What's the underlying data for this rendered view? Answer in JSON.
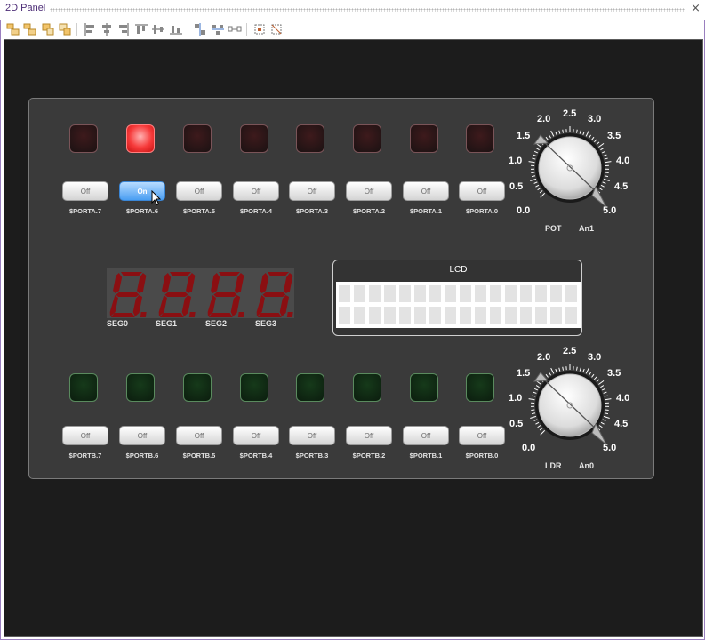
{
  "window": {
    "title": "2D Panel",
    "close_glyph": "×"
  },
  "toolbar": {
    "icons": [
      "align-left-icon",
      "align-top-icon",
      "bring-front-icon",
      "send-back-icon",
      "align-center-v-icon",
      "align-middle-icon",
      "align-right-icon",
      "align-bottom-icon",
      "distribute-h-icon",
      "distribute-v-icon",
      "space-h-icon",
      "space-v-icon",
      "space-even-icon",
      "fit-icon",
      "crop-icon"
    ]
  },
  "colors": {
    "led_red_on": "#f63a3a",
    "switch_on": "#4a9ef2",
    "panel_bg": "#3a3a3a",
    "canvas_bg": "#1c1c1c"
  },
  "porta": {
    "leds": [
      "off",
      "on",
      "off",
      "off",
      "off",
      "off",
      "off",
      "off"
    ],
    "switches": [
      {
        "label": "$PORTA.7",
        "state": "Off"
      },
      {
        "label": "$PORTA.6",
        "state": "On"
      },
      {
        "label": "$PORTA.5",
        "state": "Off"
      },
      {
        "label": "$PORTA.4",
        "state": "Off"
      },
      {
        "label": "$PORTA.3",
        "state": "Off"
      },
      {
        "label": "$PORTA.2",
        "state": "Off"
      },
      {
        "label": "$PORTA.1",
        "state": "Off"
      },
      {
        "label": "$PORTA.0",
        "state": "Off"
      }
    ]
  },
  "portb": {
    "leds": [
      "off",
      "off",
      "off",
      "off",
      "off",
      "off",
      "off",
      "off"
    ],
    "switches": [
      {
        "label": "$PORTB.7",
        "state": "Off"
      },
      {
        "label": "$PORTB.6",
        "state": "Off"
      },
      {
        "label": "$PORTB.5",
        "state": "Off"
      },
      {
        "label": "$PORTB.4",
        "state": "Off"
      },
      {
        "label": "$PORTB.3",
        "state": "Off"
      },
      {
        "label": "$PORTB.2",
        "state": "Off"
      },
      {
        "label": "$PORTB.1",
        "state": "Off"
      },
      {
        "label": "$PORTB.0",
        "state": "Off"
      }
    ]
  },
  "knob_scale": [
    "0.0",
    "0.5",
    "1.0",
    "1.5",
    "2.0",
    "2.5",
    "3.0",
    "3.5",
    "4.0",
    "4.5",
    "5.0"
  ],
  "pot": {
    "name": "POT",
    "channel": "An1",
    "value": 5.0
  },
  "ldr": {
    "name": "LDR",
    "channel": "An0",
    "value": 5.0
  },
  "seven_segment": {
    "labels": [
      "SEG0",
      "SEG1",
      "SEG2",
      "SEG3"
    ],
    "digits": [
      "8.",
      "8.",
      "8.",
      "8."
    ]
  },
  "lcd": {
    "title": "LCD",
    "rows": 2,
    "cols": 16
  }
}
